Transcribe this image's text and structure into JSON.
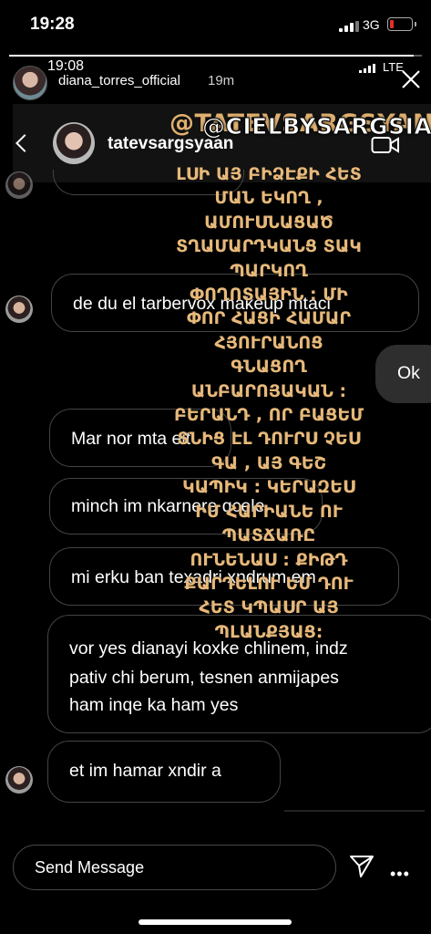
{
  "status": {
    "time": "19:28",
    "network": "3G"
  },
  "story": {
    "progress": 0.98,
    "time": "19:08",
    "network": "LTE",
    "author": "diana_torres_official",
    "age": "19m"
  },
  "dm": {
    "username": "tatevsargsyaan"
  },
  "sticker": {
    "tag_back": "@TATEVSARGSYAN",
    "tag_front": "@CIELBYSARGSIAN",
    "lines": [
      "ԼՍԻ ԱՅ ԲԻՁԷՔԻ ՀԵՏ",
      "ՄԱՆ ԵԿՈՂ ,",
      "ԱՄՈՒՍՆԱՑԱԾ",
      "ՏՂԱՄԱՐԴԿԱՆՑ ՏԱԿ",
      "ՊԱՐԿՈՂ",
      "ՓՈՂՈՏԱՅԻՆ : ՄԻ",
      "ՓՈՐ ՀԱՑԻ ՀԱՄԱՐ",
      "ՀՅՈՒՐԱՆՈՑ",
      "ԳՆԱՑՈՂ",
      "ԱՆԲԱՐՈՅԱԿԱՆ :",
      "ԲԵՐԱՆԴ , ՈՐ ԲԱՑԵՄ",
      "ՏՆԻՑ ԷԼ ԴՈՒՐՍ ՉԵՍ",
      "ԳԱ , ԱՅ ԳԵՇ",
      "ԿԱՊԻԿ : ԿԵՐԱԶԵՍ",
      "ԻՄ ՀԱՐԻԱՆԵ ՈՒ",
      "ՊԱՏՃԱՌԸ",
      "ՈՒՆԵՆԱՍ : ՔԻԹԴ",
      "ՔԱՐԴԵԼՈՒ ԵՄ ԴՈՒ",
      "ՀԵՏ ԿՊԱՍՐ ԱՅ",
      "ՊԼԱՆՔՅԱՑ:"
    ]
  },
  "messages": {
    "m1": "de du el tarbervox makeup mtaci",
    "m2": "Ok",
    "m3": "Mar nor mta eit",
    "m4": "minch im nkarnere qcele",
    "m5": "mi erku ban texadri xndrum em",
    "m6_l1": "vor yes dianayi koxke chlinem, indz",
    "m6_l2": "pativ chi berum, tesnen anmijapes",
    "m6_l3": "ham inqe ka ham yes",
    "m7": "et im hamar xndir a"
  },
  "footer": {
    "composer_label": "Send Message"
  }
}
